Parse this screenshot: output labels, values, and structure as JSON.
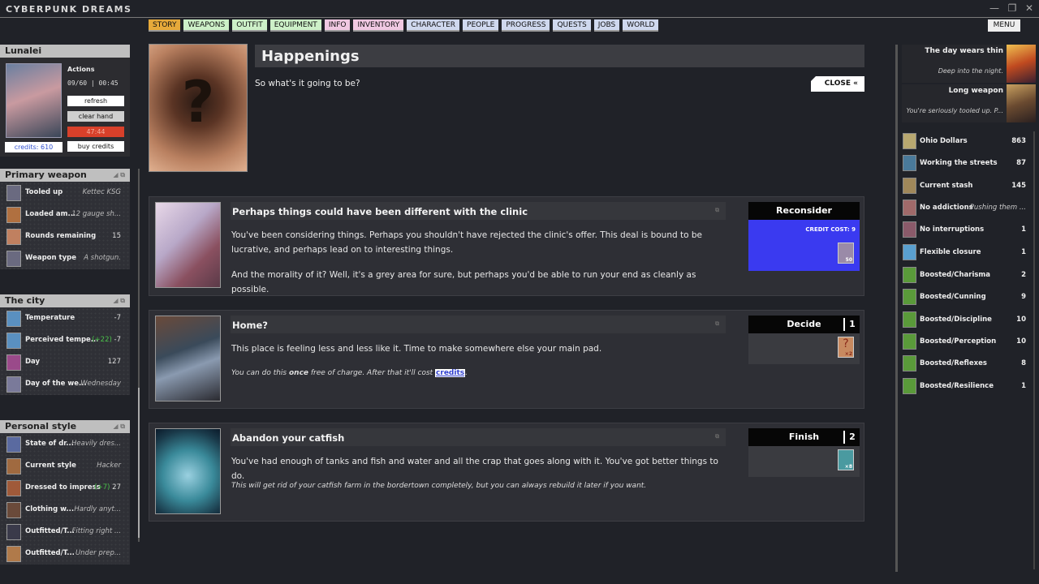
{
  "app": {
    "title": "CYBERPUNK DREAMS",
    "menu_label": "MENU"
  },
  "nav": {
    "tabs": [
      "STORY",
      "WEAPONS",
      "OUTFIT",
      "EQUIPMENT",
      "INFO",
      "INVENTORY",
      "CHARACTER",
      "PEOPLE",
      "PROGRESS",
      "QUESTS",
      "JOBS",
      "WORLD"
    ]
  },
  "character": {
    "name": "Lunalei",
    "actions_label": "Actions",
    "clock": "09/60 | 00:45",
    "refresh_label": "refresh",
    "clear_hand_label": "clear hand",
    "timer": "47:44",
    "credits": "credits: 610",
    "buy_credits_label": "buy credits"
  },
  "primary_weapon": {
    "title": "Primary weapon",
    "rows": [
      {
        "label": "Tooled up",
        "value": "Kettec KSG"
      },
      {
        "label": "Loaded am...",
        "value": "12 gauge sh..."
      },
      {
        "label": "Rounds remaining",
        "value": "15"
      },
      {
        "label": "Weapon type",
        "value": "A shotgun."
      }
    ]
  },
  "city": {
    "title": "The city",
    "rows": [
      {
        "label": "Temperature",
        "value": "-7"
      },
      {
        "label": "Perceived tempe...",
        "bonus": "(+22)",
        "value": "-7"
      },
      {
        "label": "Day",
        "value": "127"
      },
      {
        "label": "Day of the we...",
        "value": "Wednesday"
      }
    ]
  },
  "style": {
    "title": "Personal style",
    "rows": [
      {
        "label": "State of dr...",
        "value": "Heavily dres..."
      },
      {
        "label": "Current style",
        "value": "Hacker"
      },
      {
        "label": "Dressed to impress",
        "bonus": "(+7)",
        "value": "27"
      },
      {
        "label": "Clothing w...",
        "value": "Hardly anyt..."
      },
      {
        "label": "Outfitted/T...",
        "value": "Fitting right ..."
      },
      {
        "label": "Outfitted/T...",
        "value": "Under prep..."
      }
    ]
  },
  "happenings": {
    "title": "Happenings",
    "subtitle": "So what's it going to be?",
    "close_label": "CLOSE «"
  },
  "cards": [
    {
      "title": "Perhaps things could have been different with the clinic",
      "text1": "You've been considering things. Perhaps you shouldn't have rejected the clinic's offer. This deal is bound to be lucrative, and perhaps lead on to interesting things.",
      "text2": "And the morality of it? Well, it's a grey area for sure, but perhaps you'd be able to run your end as cleanly as possible.",
      "action": "Reconsider",
      "cost_label": "CREDIT COST: 9",
      "badge": "50"
    },
    {
      "title": "Home?",
      "text1": "This place is feeling less and less like it. Time to make somewhere else your main pad.",
      "note_pre": "You can do this ",
      "note_bold": "once",
      "note_mid": " free of charge. After that it'll cost ",
      "note_link": "credits",
      "note_end": ".",
      "action": "Decide",
      "num": "1",
      "badge": "×2"
    },
    {
      "title": "Abandon your catfish",
      "text1": "You've had enough of tanks and fish and water and all the crap that goes along with it. You've got better things to do.",
      "note": "This will get rid of your catfish farm in the bordertown completely, but you can always rebuild it later if you want.",
      "action": "Finish",
      "num": "2",
      "badge": "×8"
    }
  ],
  "right_top": [
    {
      "title": "The day wears thin",
      "sub": "Deep into the night."
    },
    {
      "title": "Long weapon",
      "sub": "You're seriously tooled up. P..."
    }
  ],
  "stats": [
    {
      "label": "Ohio Dollars",
      "value": "863"
    },
    {
      "label": "Working the streets",
      "value": "87"
    },
    {
      "label": "Current stash",
      "value": "145"
    },
    {
      "label": "No addictions",
      "value": "Pushing them ..."
    },
    {
      "label": "No interruptions",
      "value": "1"
    },
    {
      "label": "Flexible closure",
      "value": "1"
    },
    {
      "label": "Boosted/Charisma",
      "value": "2"
    },
    {
      "label": "Boosted/Cunning",
      "value": "9"
    },
    {
      "label": "Boosted/Discipline",
      "value": "10"
    },
    {
      "label": "Boosted/Perception",
      "value": "10"
    },
    {
      "label": "Boosted/Reflexes",
      "value": "8"
    },
    {
      "label": "Boosted/Resilience",
      "value": "1"
    }
  ]
}
